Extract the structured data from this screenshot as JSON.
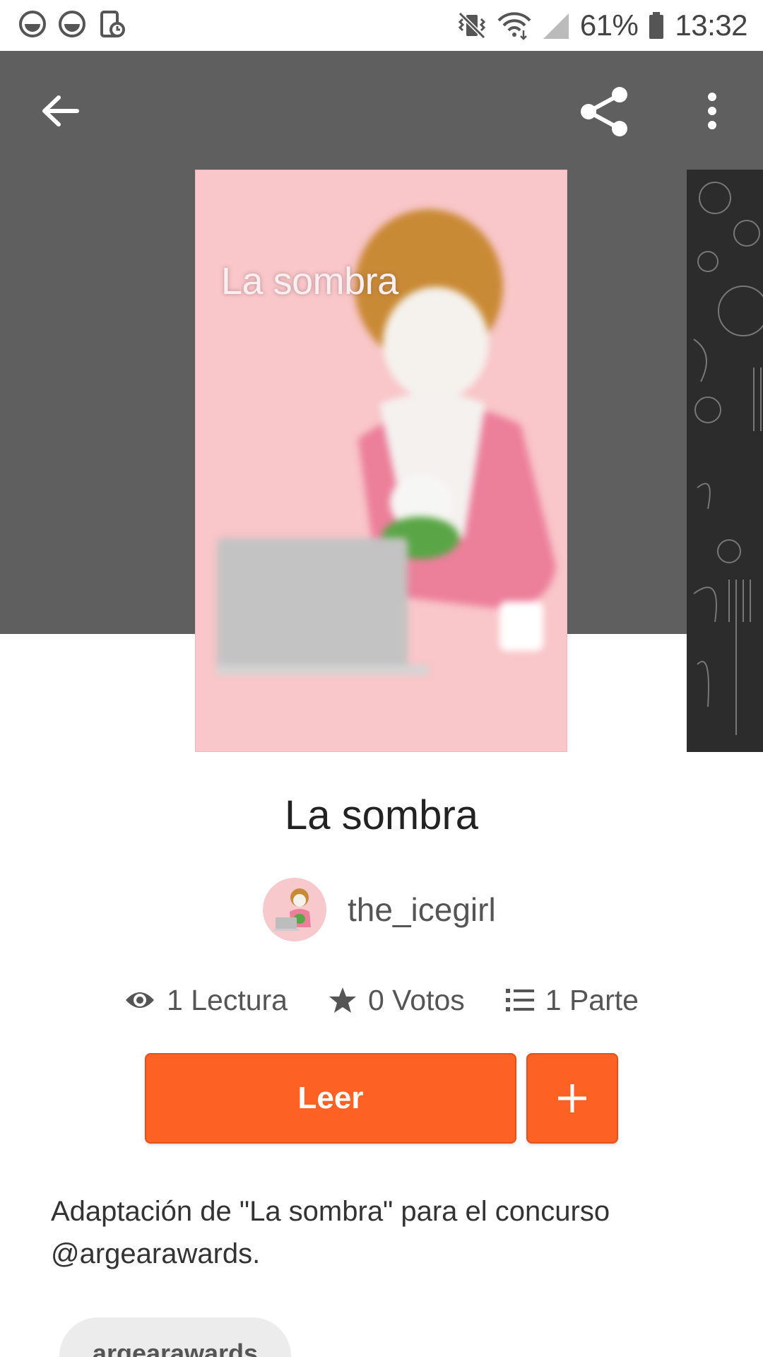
{
  "status_bar": {
    "battery": "61%",
    "time": "13:32",
    "icons": [
      "notification-face-icon",
      "notification-face-icon",
      "screen-timer-icon",
      "vibrate-icon",
      "wifi-icon",
      "signal-icon",
      "battery-icon"
    ]
  },
  "toolbar": {
    "back_icon": "arrow-left-icon",
    "share_icon": "share-icon",
    "more_icon": "more-vertical-icon"
  },
  "cover": {
    "title_text": "La sombra"
  },
  "story": {
    "title": "La sombra",
    "author": "the_icegirl",
    "stats": {
      "reads": "1 Lectura",
      "votes": "0 Votos",
      "parts": "1 Parte"
    },
    "read_label": "Leer",
    "add_label": "+",
    "description_line1": "Adaptación de \"La sombra\" para el concurso",
    "description_line2": "@argearawards.",
    "tags": [
      "argearawards"
    ]
  },
  "colors": {
    "accent": "#fd6123",
    "header": "#5f5f5f",
    "cover_bg": "#f9c6c9"
  }
}
